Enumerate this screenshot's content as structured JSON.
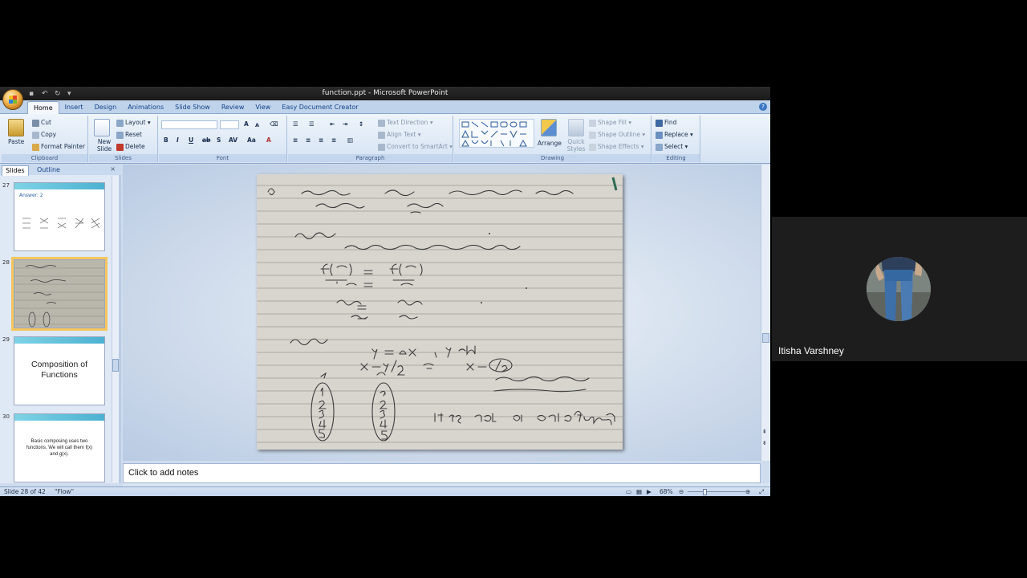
{
  "window": {
    "title": "function.ppt - Microsoft PowerPoint"
  },
  "ribbon": {
    "tabs": [
      "Home",
      "Insert",
      "Design",
      "Animations",
      "Slide Show",
      "Review",
      "View",
      "Easy Document Creator"
    ],
    "clipboard": {
      "paste": "Paste",
      "cut": "Cut",
      "copy": "Copy",
      "format_painter": "Format Painter",
      "label": "Clipboard"
    },
    "slides": {
      "new_slide": "New Slide",
      "layout": "Layout",
      "reset": "Reset",
      "delete": "Delete",
      "label": "Slides"
    },
    "font": {
      "label": "Font"
    },
    "paragraph": {
      "text_direction": "Text Direction",
      "align_text": "Align Text",
      "convert_smartart": "Convert to SmartArt",
      "label": "Paragraph"
    },
    "drawing": {
      "arrange": "Arrange",
      "quick_styles": "Quick Styles",
      "shape_fill": "Shape Fill",
      "shape_outline": "Shape Outline",
      "shape_effects": "Shape Effects",
      "label": "Drawing"
    },
    "editing": {
      "find": "Find",
      "replace": "Replace",
      "select": "Select",
      "label": "Editing"
    }
  },
  "panel": {
    "tabs": [
      "Slides",
      "Outline"
    ],
    "thumbnails": [
      {
        "number": "27",
        "title": "Answer: 2"
      },
      {
        "number": "28"
      },
      {
        "number": "29",
        "text": "Composition of Functions"
      },
      {
        "number": "30",
        "text": "Basic composing uses two functions. We will call them f(x) and g(x)."
      }
    ]
  },
  "notes": {
    "placeholder": "Click to add notes"
  },
  "status": {
    "slide_info": "Slide 28 of 42",
    "theme": "\"Flow\"",
    "zoom": "68%"
  },
  "participant": {
    "name": "Itisha Varshney"
  }
}
